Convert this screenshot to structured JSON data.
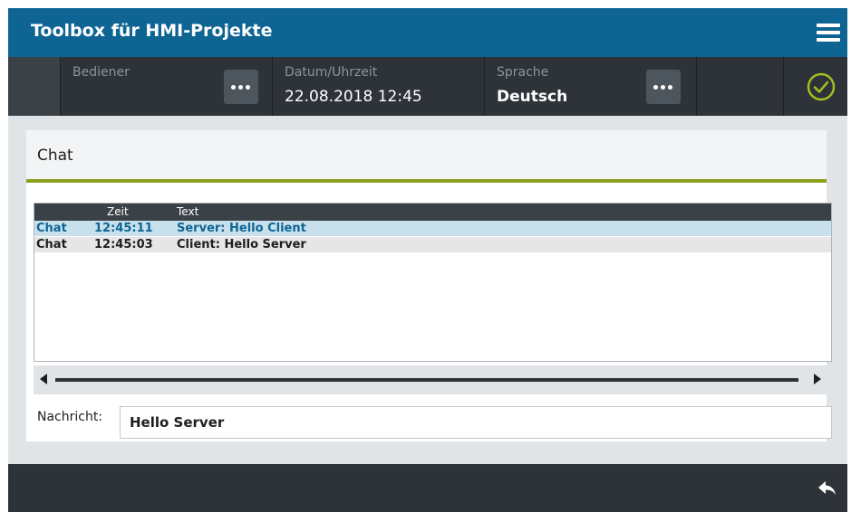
{
  "header": {
    "title": "Toolbox für HMI-Projekte",
    "menu_icon": "hamburger-menu-icon"
  },
  "statusbar": {
    "operator_label": "Bediener",
    "datetime_label": "Datum/Uhrzeit",
    "datetime_value": "22.08.2018 12:45",
    "language_label": "Sprache",
    "language_value": "Deutsch",
    "more_icon": "ellipsis-icon",
    "status_icon": "check-circle-icon"
  },
  "chat": {
    "title": "Chat",
    "columns": [
      "",
      "Zeit",
      "Text"
    ],
    "rows": [
      {
        "category": "Chat",
        "time": "12:45:11",
        "text": "Server: Hello Client",
        "selected": true
      },
      {
        "category": "Chat",
        "time": "12:45:03",
        "text": "Client: Hello Server",
        "selected": false
      }
    ],
    "message_label": "Nachricht:",
    "message_value": "Hello Server"
  },
  "footer": {
    "back_icon": "reply-arrow-icon"
  },
  "colors": {
    "title_bar": "#0e6594",
    "status_bar": "#2d3339",
    "accent_line": "#8ca01d",
    "check_icon": "#a4bd1e",
    "selected_row_bg": "#c8e0ec",
    "selected_row_text": "#0e6594",
    "normal_row_bg": "#e6e6e6"
  }
}
